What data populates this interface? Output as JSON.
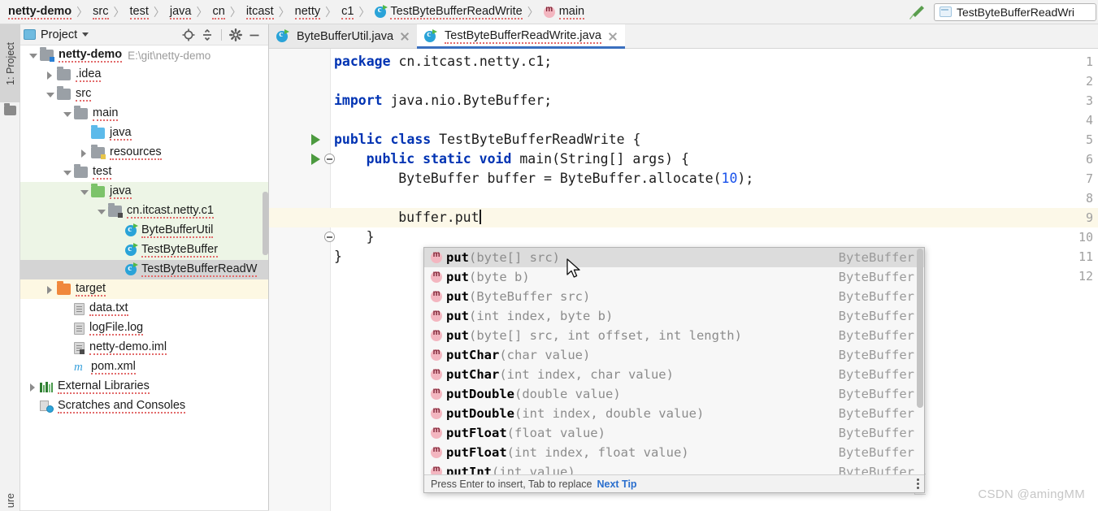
{
  "window": {
    "run_config": "TestByteBufferReadWri",
    "build_icon": "hammer-icon",
    "watermark": "CSDN @amingMM"
  },
  "breadcrumb": {
    "items": [
      {
        "label": "netty-demo",
        "icon": "",
        "bold": true
      },
      {
        "label": "src",
        "icon": ""
      },
      {
        "label": "test",
        "icon": ""
      },
      {
        "label": "java",
        "icon": ""
      },
      {
        "label": "cn",
        "icon": ""
      },
      {
        "label": "itcast",
        "icon": ""
      },
      {
        "label": "netty",
        "icon": ""
      },
      {
        "label": "c1",
        "icon": ""
      },
      {
        "label": "TestByteBufferReadWrite",
        "icon": "class-icon"
      },
      {
        "label": "main",
        "icon": "method-icon"
      }
    ]
  },
  "toolstrip": {
    "project_button": "1: Project",
    "bottom_button": "ure"
  },
  "project_panel": {
    "title": "Project",
    "tools": [
      "locate-icon",
      "collapse-all-icon",
      "settings-gear-icon",
      "minimize-icon"
    ],
    "tree": [
      {
        "label": "netty-demo",
        "path": "E:\\git\\netty-demo",
        "indent": 0,
        "arrow": "down",
        "icon": "folder-module",
        "bold": true,
        "hl": "none"
      },
      {
        "label": ".idea",
        "path": "",
        "indent": 1,
        "arrow": "right",
        "icon": "folder-gray",
        "bold": false,
        "hl": "none"
      },
      {
        "label": "src",
        "path": "",
        "indent": 1,
        "arrow": "down",
        "icon": "folder-gray",
        "bold": false,
        "hl": "none"
      },
      {
        "label": "main",
        "path": "",
        "indent": 2,
        "arrow": "down",
        "icon": "folder-gray",
        "bold": false,
        "hl": "none"
      },
      {
        "label": "java",
        "path": "",
        "indent": 3,
        "arrow": "none",
        "icon": "folder-blue",
        "bold": false,
        "hl": "none"
      },
      {
        "label": "resources",
        "path": "",
        "indent": 3,
        "arrow": "right",
        "icon": "folder-resources",
        "bold": false,
        "hl": "none"
      },
      {
        "label": "test",
        "path": "",
        "indent": 2,
        "arrow": "down",
        "icon": "folder-gray",
        "bold": false,
        "hl": "none"
      },
      {
        "label": "java",
        "path": "",
        "indent": 3,
        "arrow": "down",
        "icon": "folder-green",
        "bold": false,
        "hl": "green"
      },
      {
        "label": "cn.itcast.netty.c1",
        "path": "",
        "indent": 4,
        "arrow": "down",
        "icon": "folder-package",
        "bold": false,
        "hl": "green"
      },
      {
        "label": "ByteBufferUtil",
        "path": "",
        "indent": 5,
        "arrow": "none",
        "icon": "class-icon",
        "bold": false,
        "hl": "green"
      },
      {
        "label": "TestByteBuffer",
        "path": "",
        "indent": 5,
        "arrow": "none",
        "icon": "class-icon",
        "bold": false,
        "hl": "green"
      },
      {
        "label": "TestByteBufferReadW",
        "path": "",
        "indent": 5,
        "arrow": "none",
        "icon": "class-icon",
        "bold": false,
        "hl": "selected"
      },
      {
        "label": "target",
        "path": "",
        "indent": 1,
        "arrow": "right",
        "icon": "folder-orange",
        "bold": false,
        "hl": "yellow"
      },
      {
        "label": "data.txt",
        "path": "",
        "indent": 2,
        "arrow": "none",
        "icon": "file-icon",
        "bold": false,
        "hl": "none"
      },
      {
        "label": "logFile.log",
        "path": "",
        "indent": 2,
        "arrow": "none",
        "icon": "file-icon",
        "bold": false,
        "hl": "none"
      },
      {
        "label": "netty-demo.iml",
        "path": "",
        "indent": 2,
        "arrow": "none",
        "icon": "iml-icon",
        "bold": false,
        "hl": "none"
      },
      {
        "label": "pom.xml",
        "path": "",
        "indent": 2,
        "arrow": "none",
        "icon": "maven-icon",
        "bold": false,
        "hl": "none"
      },
      {
        "label": "External Libraries",
        "path": "",
        "indent": 0,
        "arrow": "right",
        "icon": "library-icon",
        "bold": false,
        "hl": "none"
      },
      {
        "label": "Scratches and Consoles",
        "path": "",
        "indent": 0,
        "arrow": "none",
        "icon": "scratches-icon",
        "bold": false,
        "hl": "none"
      }
    ]
  },
  "editor": {
    "tabs": [
      {
        "label": "ByteBufferUtil.java",
        "active": false
      },
      {
        "label": "TestByteBufferReadWrite.java",
        "active": true
      }
    ],
    "line_numbers": [
      "1",
      "2",
      "3",
      "4",
      "5",
      "6",
      "7",
      "8",
      "9",
      "10",
      "11",
      "12"
    ],
    "caret_line": 9,
    "lines": [
      {
        "n": 1,
        "indent": 0,
        "tokens": [
          {
            "t": "package ",
            "c": "kw"
          },
          {
            "t": "cn.itcast.netty.c1;",
            "c": ""
          }
        ]
      },
      {
        "n": 2,
        "indent": 0,
        "tokens": []
      },
      {
        "n": 3,
        "indent": 0,
        "tokens": [
          {
            "t": "import ",
            "c": "kw"
          },
          {
            "t": "java.nio.ByteBuffer;",
            "c": ""
          }
        ]
      },
      {
        "n": 4,
        "indent": 0,
        "tokens": []
      },
      {
        "n": 5,
        "indent": 0,
        "tokens": [
          {
            "t": "public class ",
            "c": "kw"
          },
          {
            "t": "TestByteBufferReadWrite {",
            "c": ""
          }
        ]
      },
      {
        "n": 6,
        "indent": 1,
        "tokens": [
          {
            "t": "public static void ",
            "c": "kw"
          },
          {
            "t": "main(String[] args) {",
            "c": ""
          }
        ]
      },
      {
        "n": 7,
        "indent": 2,
        "tokens": [
          {
            "t": "ByteBuffer buffer = ByteBuffer.allocate(",
            "c": ""
          },
          {
            "t": "10",
            "c": "num"
          },
          {
            "t": ");",
            "c": ""
          }
        ]
      },
      {
        "n": 8,
        "indent": 0,
        "tokens": []
      },
      {
        "n": 9,
        "indent": 2,
        "tokens": [
          {
            "t": "buffer.put",
            "c": ""
          }
        ],
        "caret": true
      },
      {
        "n": 10,
        "indent": 1,
        "tokens": [
          {
            "t": "}",
            "c": ""
          }
        ]
      },
      {
        "n": 11,
        "indent": 0,
        "tokens": [
          {
            "t": "}",
            "c": ""
          }
        ]
      },
      {
        "n": 12,
        "indent": 0,
        "tokens": []
      }
    ],
    "run_markers": [
      5,
      6
    ],
    "fold_markers": [
      6,
      10
    ]
  },
  "autocomplete": {
    "items": [
      {
        "name": "put",
        "args": "(byte[] src)",
        "type": "ByteBuffer",
        "selected": true
      },
      {
        "name": "put",
        "args": "(byte b)",
        "type": "ByteBuffer",
        "selected": false
      },
      {
        "name": "put",
        "args": "(ByteBuffer src)",
        "type": "ByteBuffer",
        "selected": false
      },
      {
        "name": "put",
        "args": "(int index, byte b)",
        "type": "ByteBuffer",
        "selected": false
      },
      {
        "name": "put",
        "args": "(byte[] src, int offset, int length)",
        "type": "ByteBuffer",
        "selected": false
      },
      {
        "name": "putChar",
        "args": "(char value)",
        "type": "ByteBuffer",
        "selected": false
      },
      {
        "name": "putChar",
        "args": "(int index, char value)",
        "type": "ByteBuffer",
        "selected": false
      },
      {
        "name": "putDouble",
        "args": "(double value)",
        "type": "ByteBuffer",
        "selected": false
      },
      {
        "name": "putDouble",
        "args": "(int index, double value)",
        "type": "ByteBuffer",
        "selected": false
      },
      {
        "name": "putFloat",
        "args": "(float value)",
        "type": "ByteBuffer",
        "selected": false
      },
      {
        "name": "putFloat",
        "args": "(int index, float value)",
        "type": "ByteBuffer",
        "selected": false
      },
      {
        "name": "putInt",
        "args": "(int value)",
        "type": "ByteBuffer",
        "selected": false
      }
    ],
    "footer_hint": "Press Enter to insert, Tab to replace",
    "footer_link": "Next Tip"
  },
  "colors": {
    "accent_blue": "#3a6fbf",
    "keyword_blue": "#0033b3",
    "number_blue": "#1750eb",
    "selection_gray": "#dcdcdc",
    "test_root_green": "#edf5e6",
    "excluded_yellow": "#fdf8e3",
    "caret_line": "#fcf8e8"
  }
}
